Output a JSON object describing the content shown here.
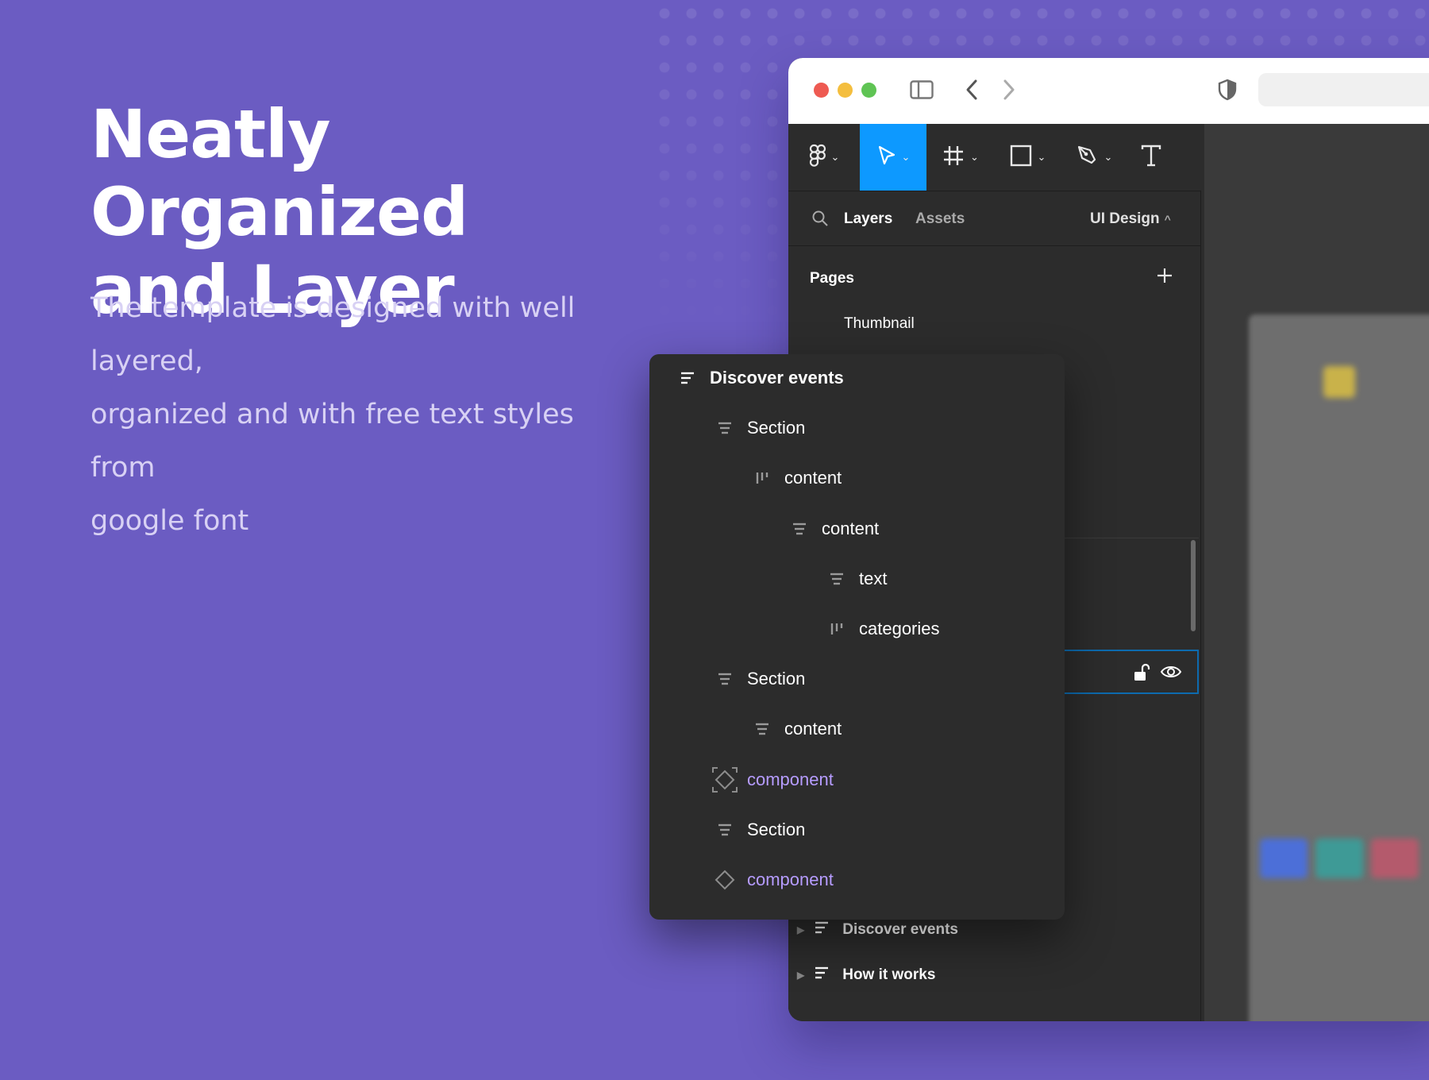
{
  "hero": {
    "title_line1": "Neatly Organized",
    "title_line2": "and Layer",
    "description_line1": "The template is designed with well layered,",
    "description_line2": "organized and with free text styles from",
    "description_line3": "google font"
  },
  "browser": {
    "traffic_lights": [
      "#EE5A52",
      "#F4BE3E",
      "#5FC454"
    ],
    "icons": [
      "sidebar-icon",
      "back-arrow-icon",
      "forward-arrow-icon",
      "shield-icon"
    ]
  },
  "toolbar": {
    "tools": [
      "figma-menu-icon",
      "move-tool-icon",
      "frame-tool-icon",
      "rectangle-tool-icon",
      "pen-tool-icon",
      "text-tool-icon"
    ],
    "active_color": "#0D99FF"
  },
  "panel": {
    "tab_layers": "Layers",
    "tab_assets": "Assets",
    "page_selector": "UI Design",
    "pages_heading": "Pages",
    "pages": [
      "Thumbnail"
    ],
    "bottom_layers": [
      "Discover events",
      "How it works"
    ]
  },
  "layer_tree": {
    "items": [
      {
        "label": "Discover events",
        "icon": "frame-vertical-icon",
        "depth": 0,
        "kind": "frame"
      },
      {
        "label": "Section",
        "icon": "frame-vertical-icon",
        "depth": 1,
        "kind": "frame"
      },
      {
        "label": "content",
        "icon": "frame-horizontal-icon",
        "depth": 2,
        "kind": "frame"
      },
      {
        "label": "content",
        "icon": "frame-vertical-icon",
        "depth": 3,
        "kind": "frame"
      },
      {
        "label": "text",
        "icon": "frame-vertical-icon",
        "depth": 4,
        "kind": "frame"
      },
      {
        "label": "categories",
        "icon": "frame-horizontal-icon",
        "depth": 4,
        "kind": "frame"
      },
      {
        "label": "Section",
        "icon": "frame-vertical-icon",
        "depth": 1,
        "kind": "frame"
      },
      {
        "label": "content",
        "icon": "frame-vertical-icon",
        "depth": 2,
        "kind": "frame"
      },
      {
        "label": "component",
        "icon": "component-instance-icon",
        "depth": 1,
        "kind": "component"
      },
      {
        "label": "Section",
        "icon": "frame-vertical-icon",
        "depth": 1,
        "kind": "frame"
      },
      {
        "label": "component",
        "icon": "component-icon",
        "depth": 1,
        "kind": "component"
      }
    ],
    "component_color": "#B69CFF"
  }
}
